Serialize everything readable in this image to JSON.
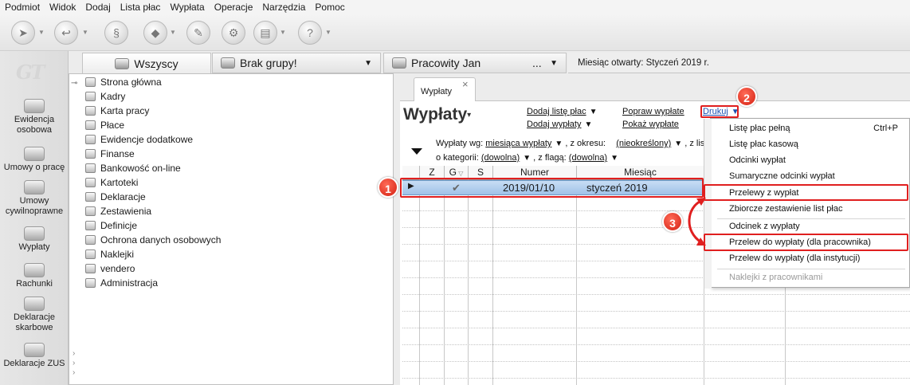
{
  "menubar": [
    "Podmiot",
    "Widok",
    "Dodaj",
    "Lista płac",
    "Wypłata",
    "Operacje",
    "Narzędzia",
    "Pomoc"
  ],
  "leftnav": {
    "logo": "GT",
    "items": [
      {
        "label": "Ewidencja osobowa",
        "icon": "person-icon"
      },
      {
        "label": "Umowy o pracę",
        "icon": "contract-icon"
      },
      {
        "label": "Umowy cywilnoprawne",
        "icon": "civil-contract-icon"
      },
      {
        "label": "Wypłaty",
        "icon": "payout-icon"
      },
      {
        "label": "Rachunki",
        "icon": "bill-icon"
      },
      {
        "label": "Deklaracje skarbowe",
        "icon": "tax-declaration-icon"
      },
      {
        "label": "Deklaracje ZUS",
        "icon": "zus-icon"
      }
    ]
  },
  "groups": {
    "all": "Wszyscy",
    "nogroup": "Brak grupy!",
    "employee": "Pracowity Jan",
    "employee_more": "...",
    "month": "Miesiąc otwarty:  Styczeń 2019 r."
  },
  "tree": [
    "Strona główna",
    "Kadry",
    "Karta pracy",
    "Płace",
    "Ewidencje dodatkowe",
    "Finanse",
    "Bankowość on-line",
    "Kartoteki",
    "Deklaracje",
    "Zestawienia",
    "Definicje",
    "Ochrona danych osobowych",
    "Naklejki",
    "vendero",
    "Administracja"
  ],
  "doc": {
    "tab": "Wypłaty",
    "title": "Wypłaty",
    "links": {
      "dodaj_liste": "Dodaj listę płac",
      "dodaj_wyplaty": "Dodaj wypłaty",
      "popraw": "Popraw wypłate",
      "pokaz": "Pokaż wypłate",
      "drukuj": "Drukuj"
    },
    "filters": {
      "wg_label": "Wypłaty wg:",
      "wg_value": "miesiąca wypłaty",
      "okres_label": ", z okresu:",
      "okres_value": "(nieokreślony)",
      "lista_label": ", z list",
      "kat_label": "o kategorii:",
      "kat_value": "(dowolna)",
      "flaga_label": ", z flagą:",
      "flaga_value": "(dowolna)"
    }
  },
  "grid": {
    "headers": [
      "Z",
      "G",
      "S",
      "Numer",
      "Miesiąc"
    ],
    "rows": [
      {
        "marker": "▶",
        "g": "✔",
        "numer": "2019/01/10",
        "miesiac": "styczeń 2019"
      }
    ]
  },
  "print_menu": [
    {
      "label": "Listę płac pełną",
      "shortcut": "Ctrl+P"
    },
    {
      "label": "Listę płac kasową",
      "shortcut": ""
    },
    {
      "label": "Odcinki wypłat",
      "shortcut": ""
    },
    {
      "label": "Sumaryczne odcinki wypłat",
      "shortcut": ""
    },
    {
      "label": "Przelewy z wypłat",
      "shortcut": ""
    },
    {
      "label": "Zbiorcze zestawienie list płac",
      "shortcut": ""
    },
    {
      "label": "Odcinek z wypłaty",
      "shortcut": ""
    },
    {
      "label": "Przelew do wypłaty (dla pracownika)",
      "shortcut": ""
    },
    {
      "label": "Przelew do wypłaty (dla instytucji)",
      "shortcut": ""
    },
    {
      "label": "Naklejki z pracownikami",
      "shortcut": "",
      "disabled": true
    }
  ],
  "annotations": {
    "step1": "1",
    "step2": "2",
    "step3": "3"
  },
  "colors": {
    "annotation_red": "#e01f1f",
    "selection_blue": "#9fc2e8"
  }
}
